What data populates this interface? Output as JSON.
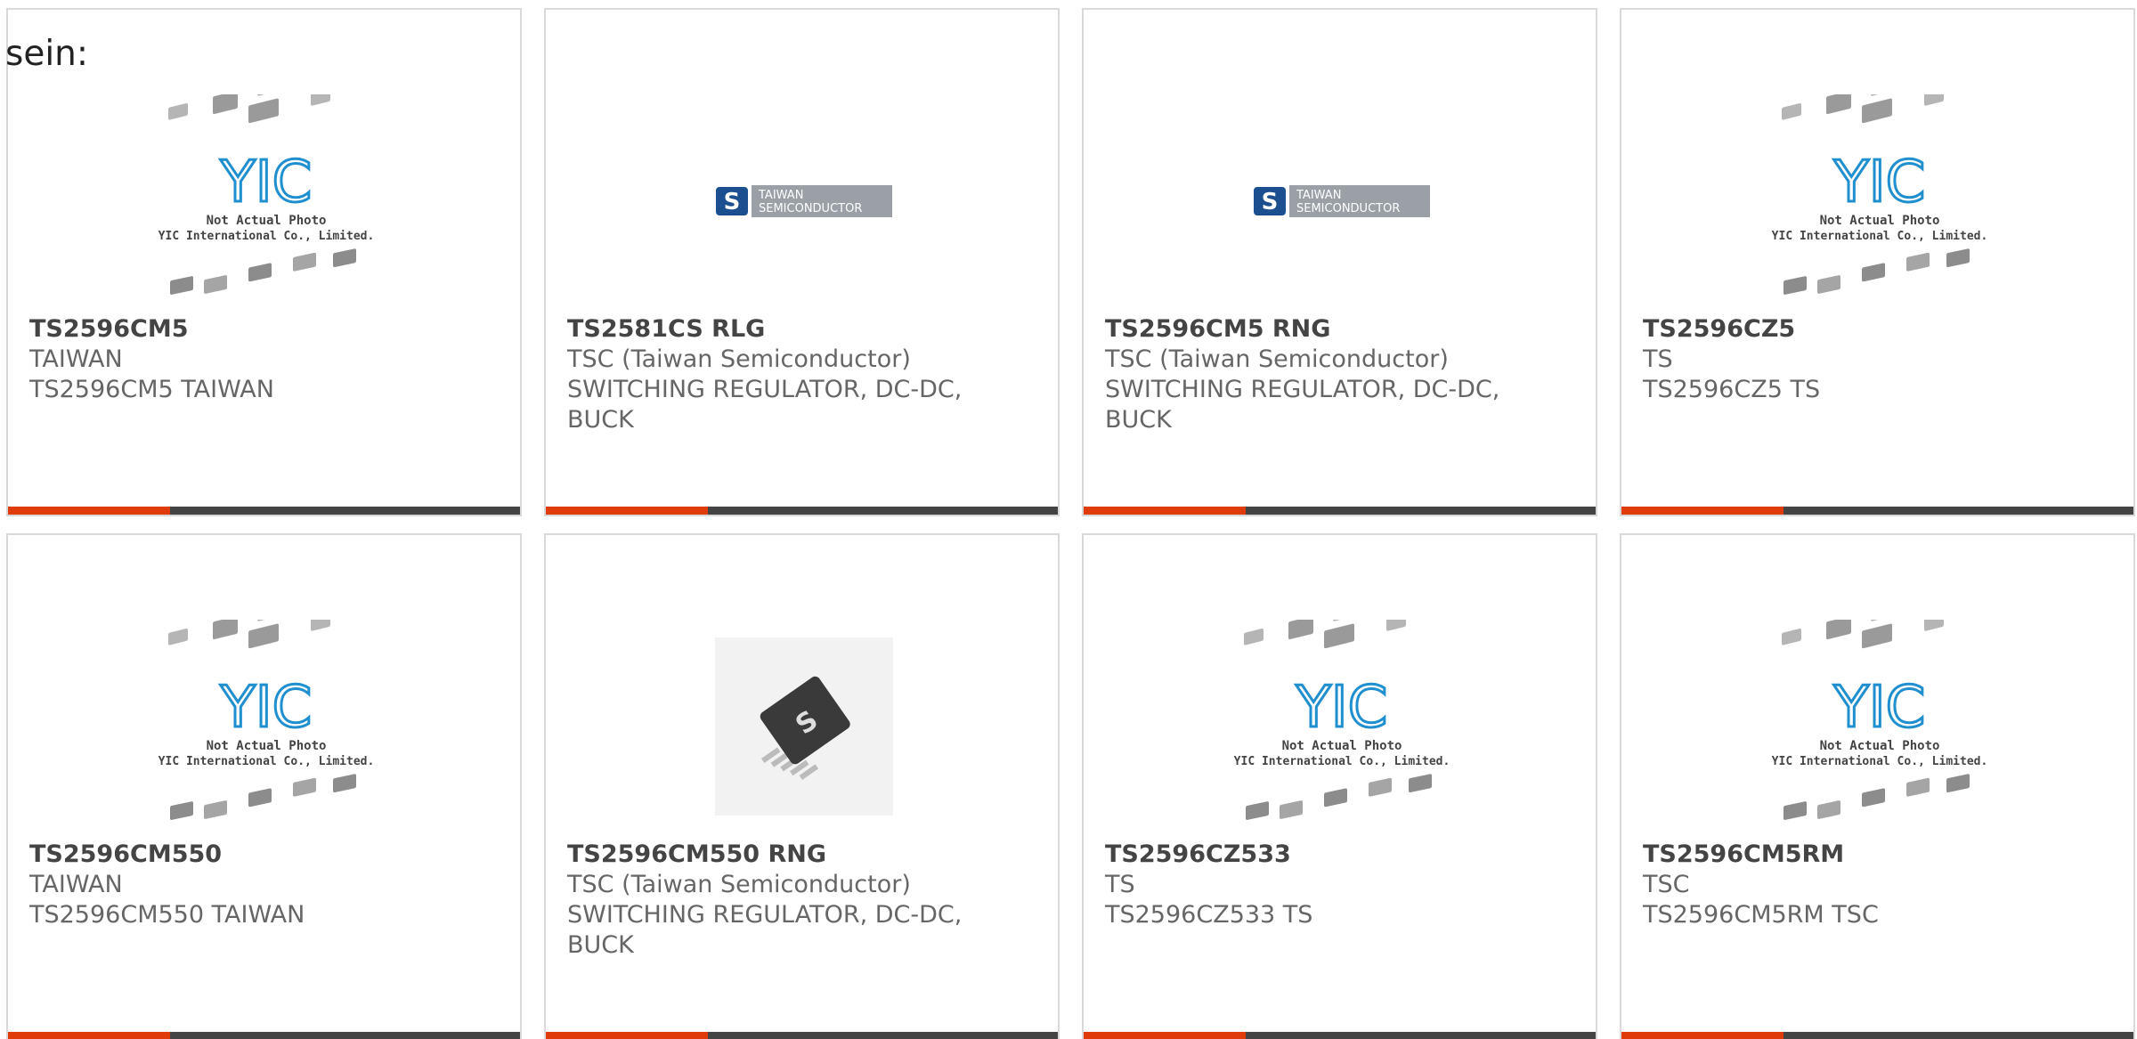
{
  "intro_text": "sein:",
  "placeholder": {
    "brand": "YIC",
    "line1": "Not Actual Photo",
    "line2": "YIC International Co., Limited."
  },
  "tsc_logo": {
    "line1": "TAIWAN",
    "line2": "SEMICONDUCTOR"
  },
  "colors": {
    "accent": "#e03b0b",
    "bar": "#444444",
    "border": "#d9d9d9",
    "logo_blue": "#1f8fcf"
  },
  "products": [
    {
      "part": "TS2596CM5",
      "maker": "TAIWAN",
      "desc": [
        "TS2596CM5 TAIWAN"
      ],
      "image": "placeholder"
    },
    {
      "part": "TS2581CS RLG",
      "maker": "TSC (Taiwan Semiconductor)",
      "desc": [
        "SWITCHING REGULATOR, DC-DC,",
        "BUCK"
      ],
      "image": "tsc-logo"
    },
    {
      "part": "TS2596CM5 RNG",
      "maker": "TSC (Taiwan Semiconductor)",
      "desc": [
        "SWITCHING REGULATOR, DC-DC,",
        "BUCK"
      ],
      "image": "tsc-logo"
    },
    {
      "part": "TS2596CZ5",
      "maker": "TS",
      "desc": [
        "TS2596CZ5 TS"
      ],
      "image": "placeholder"
    },
    {
      "part": "TS2596CM550",
      "maker": "TAIWAN",
      "desc": [
        "TS2596CM550 TAIWAN"
      ],
      "image": "placeholder"
    },
    {
      "part": "TS2596CM550 RNG",
      "maker": "TSC (Taiwan Semiconductor)",
      "desc": [
        "SWITCHING REGULATOR, DC-DC,",
        "BUCK"
      ],
      "image": "chip-photo"
    },
    {
      "part": "TS2596CZ533",
      "maker": "TS",
      "desc": [
        "TS2596CZ533 TS"
      ],
      "image": "placeholder"
    },
    {
      "part": "TS2596CM5RM",
      "maker": "TSC",
      "desc": [
        "TS2596CM5RM TSC"
      ],
      "image": "placeholder"
    }
  ]
}
